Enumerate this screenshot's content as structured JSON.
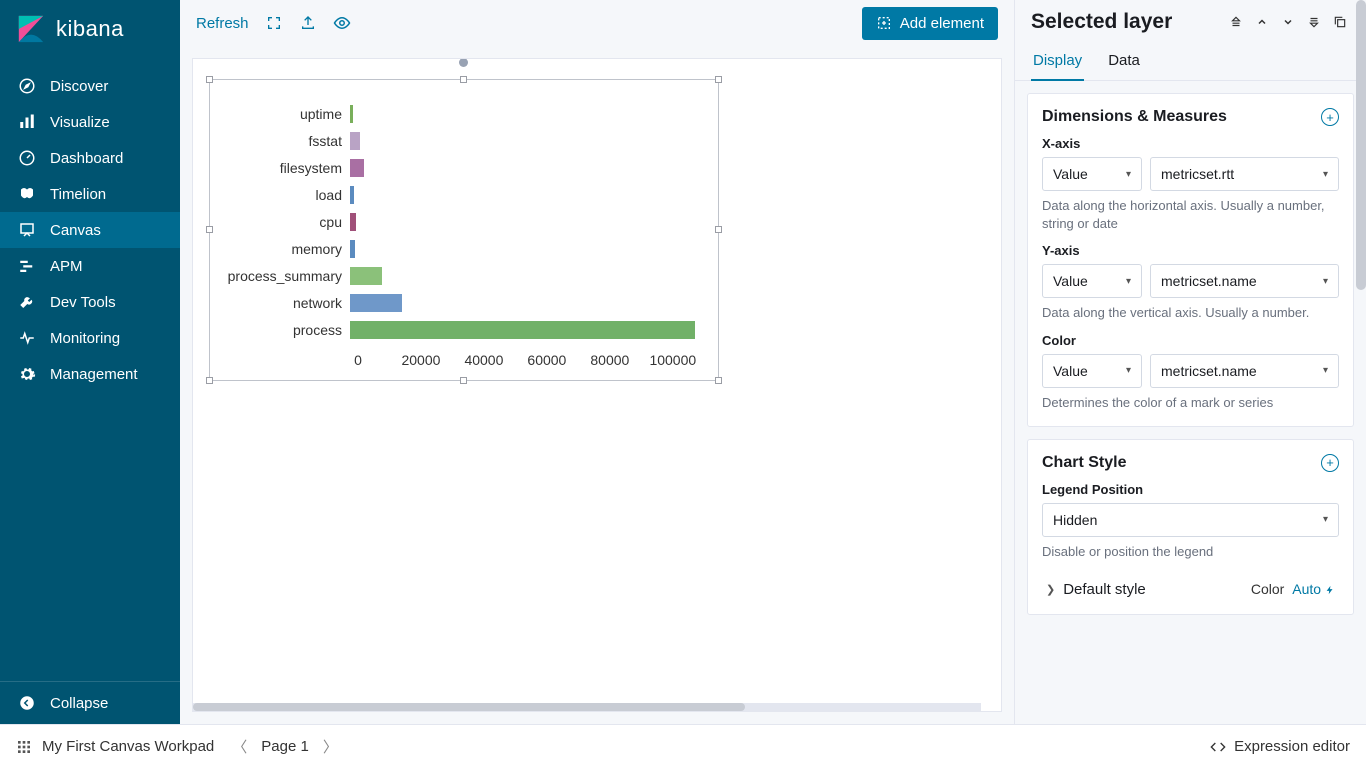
{
  "brand": "kibana",
  "sidebar": {
    "items": [
      {
        "label": "Discover"
      },
      {
        "label": "Visualize"
      },
      {
        "label": "Dashboard"
      },
      {
        "label": "Timelion"
      },
      {
        "label": "Canvas"
      },
      {
        "label": "APM"
      },
      {
        "label": "Dev Tools"
      },
      {
        "label": "Monitoring"
      },
      {
        "label": "Management"
      }
    ],
    "collapse": "Collapse"
  },
  "toolbar": {
    "refresh": "Refresh",
    "add_element": "Add element"
  },
  "chart_data": {
    "type": "bar",
    "orientation": "horizontal",
    "categories": [
      "uptime",
      "fsstat",
      "filesystem",
      "load",
      "cpu",
      "memory",
      "process_summary",
      "network",
      "process"
    ],
    "values": [
      800,
      3200,
      4200,
      1200,
      1800,
      1400,
      10000,
      16000,
      107000
    ],
    "colors": [
      "#79af5b",
      "#b9a3c5",
      "#a96fa3",
      "#5b8bbf",
      "#a05079",
      "#5b8bbf",
      "#8bc17a",
      "#6f98c9",
      "#71b168"
    ],
    "xticks": [
      0,
      20000,
      40000,
      60000,
      80000,
      100000
    ],
    "xmax": 108000,
    "xlabel": "",
    "ylabel": "",
    "title": ""
  },
  "right": {
    "title": "Selected layer",
    "tabs": {
      "display": "Display",
      "data": "Data"
    },
    "dims": {
      "title": "Dimensions & Measures",
      "x_label": "X-axis",
      "x_type": "Value",
      "x_field": "metricset.rtt",
      "x_hint": "Data along the horizontal axis. Usually a number, string or date",
      "y_label": "Y-axis",
      "y_type": "Value",
      "y_field": "metricset.name",
      "y_hint": "Data along the vertical axis. Usually a number.",
      "c_label": "Color",
      "c_type": "Value",
      "c_field": "metricset.name",
      "c_hint": "Determines the color of a mark or series"
    },
    "style": {
      "title": "Chart Style",
      "legend_label": "Legend Position",
      "legend_value": "Hidden",
      "legend_hint": "Disable or position the legend",
      "default_style": "Default style",
      "color_label": "Color",
      "color_value": "Auto"
    }
  },
  "footer": {
    "workpad": "My First Canvas Workpad",
    "page": "Page 1",
    "expression": "Expression editor"
  }
}
